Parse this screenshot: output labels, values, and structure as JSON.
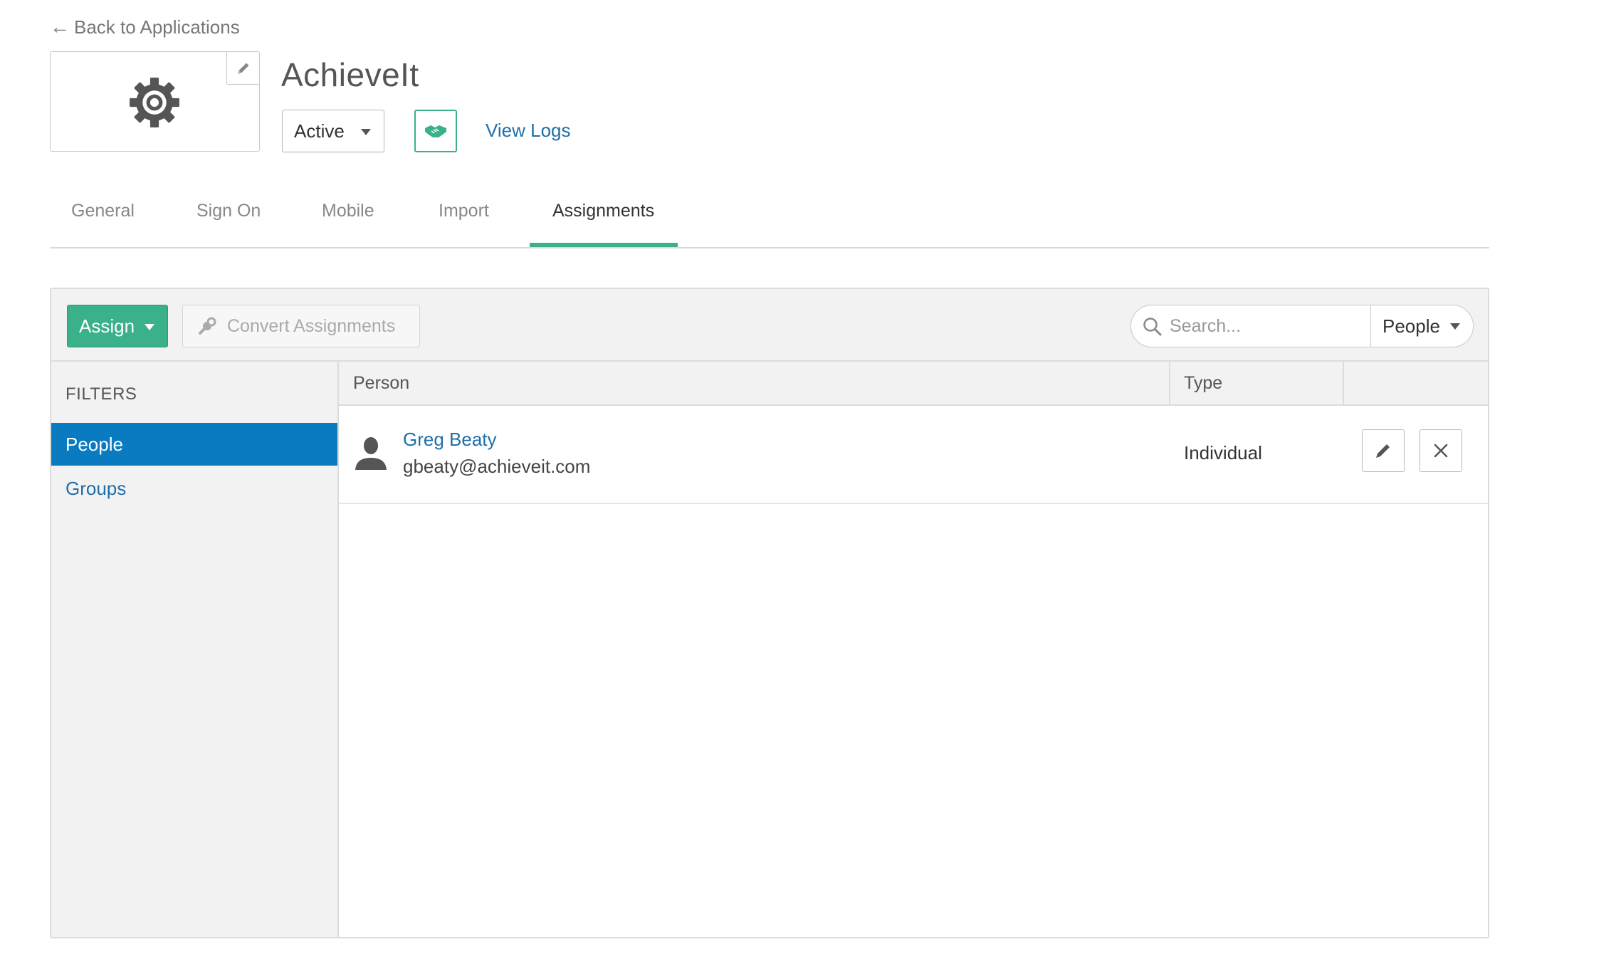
{
  "nav": {
    "back_label": "Back to Applications"
  },
  "app": {
    "title": "AchieveIt",
    "status": "Active",
    "view_logs": "View Logs",
    "accent_color": "#3bb18b",
    "link_color": "#1e6fa8"
  },
  "icons": {
    "logo": "gear-icon",
    "edit_logo": "pencil-icon",
    "provisioning": "handshake-icon",
    "search": "search-icon",
    "convert": "wrench-icon",
    "person": "person-icon",
    "row_edit": "pencil-icon",
    "row_remove": "close-icon"
  },
  "tabs": [
    {
      "label": "General",
      "active": false
    },
    {
      "label": "Sign On",
      "active": false
    },
    {
      "label": "Mobile",
      "active": false
    },
    {
      "label": "Import",
      "active": false
    },
    {
      "label": "Assignments",
      "active": true
    }
  ],
  "toolbar": {
    "assign_label": "Assign",
    "convert_label": "Convert Assignments",
    "search_placeholder": "Search...",
    "search_scope": "People"
  },
  "filters": {
    "heading": "FILTERS",
    "items": [
      {
        "label": "People",
        "active": true
      },
      {
        "label": "Groups",
        "active": false
      }
    ]
  },
  "table": {
    "columns": [
      "Person",
      "Type"
    ],
    "rows": [
      {
        "name": "Greg Beaty",
        "email": "gbeaty@achieveit.com",
        "type": "Individual"
      }
    ]
  }
}
